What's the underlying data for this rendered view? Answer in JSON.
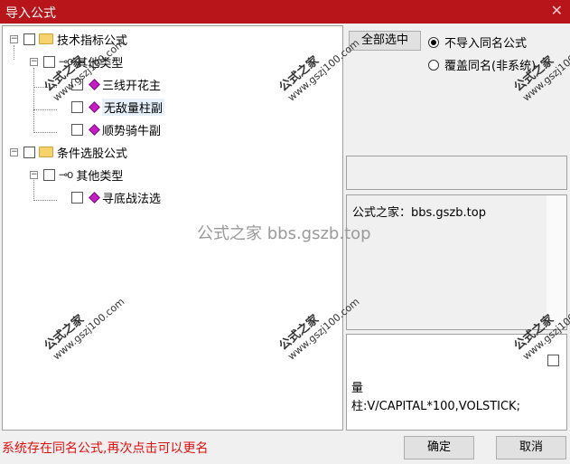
{
  "window": {
    "title": "导入公式",
    "close_glyph": "✕"
  },
  "tree": {
    "groups": [
      {
        "label": "技术指标公式",
        "sub": "其他类型",
        "items": [
          "三线开花主",
          "无敌量柱副",
          "顺势骑牛副"
        ],
        "selected_index": 1
      },
      {
        "label": "条件选股公式",
        "sub": "其他类型",
        "items": [
          "寻底战法选"
        ]
      }
    ]
  },
  "options": {
    "select_all_label": "全部选中",
    "radio_skip_label": "不导入同名公式",
    "radio_overwrite_label": "覆盖同名(非系统)",
    "selected_radio": "skip"
  },
  "description": {
    "text": "公式之家：bbs.gszb.top"
  },
  "code": {
    "line1": "量",
    "line2": "柱:V/CAPITAL*100,VOLSTICK;"
  },
  "status": {
    "message": "系统存在同名公式,再次点击可以更名"
  },
  "buttons": {
    "ok_label": "确定",
    "cancel_label": "取消"
  },
  "watermark": {
    "center_text": "公式之家 bbs.gszb.top",
    "stamp_title": "公式之家",
    "stamp_url": "www.gszj100.com"
  }
}
